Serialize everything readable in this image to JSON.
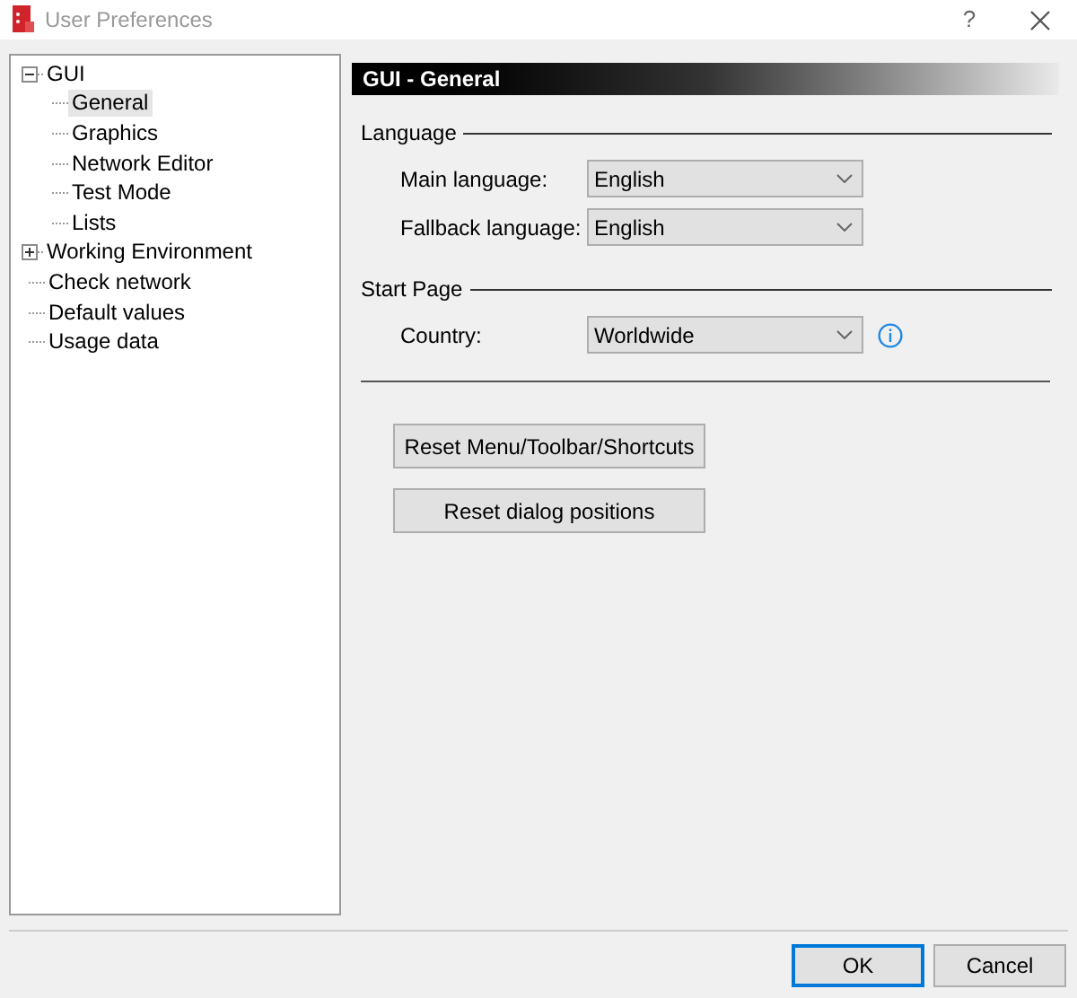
{
  "window": {
    "title": "User Preferences",
    "help": "?"
  },
  "tree": [
    {
      "label": "GUI",
      "expanded": true,
      "selected": false,
      "children": [
        {
          "label": "General",
          "selected": true
        },
        {
          "label": "Graphics",
          "selected": false
        },
        {
          "label": "Network Editor",
          "selected": false
        },
        {
          "label": "Test Mode",
          "selected": false
        },
        {
          "label": "Lists",
          "selected": false
        }
      ]
    },
    {
      "label": "Working Environment",
      "expanded": false,
      "selected": false
    },
    {
      "label": "Check network",
      "selected": false
    },
    {
      "label": "Default values",
      "selected": false
    },
    {
      "label": "Usage data",
      "selected": false
    }
  ],
  "panel": {
    "title": "GUI - General",
    "sections": [
      {
        "title": "Language",
        "fields": [
          {
            "label": "Main language:",
            "value": "English",
            "info": false
          },
          {
            "label": "Fallback language:",
            "value": "English",
            "info": false
          }
        ]
      },
      {
        "title": "Start Page",
        "fields": [
          {
            "label": "Country:",
            "value": "Worldwide",
            "info": true
          }
        ]
      }
    ],
    "buttons": [
      "Reset Menu/Toolbar/Shortcuts",
      "Reset dialog positions"
    ]
  },
  "footer": {
    "buttons": [
      {
        "label": "OK",
        "default": true
      },
      {
        "label": "Cancel",
        "default": false
      }
    ]
  }
}
